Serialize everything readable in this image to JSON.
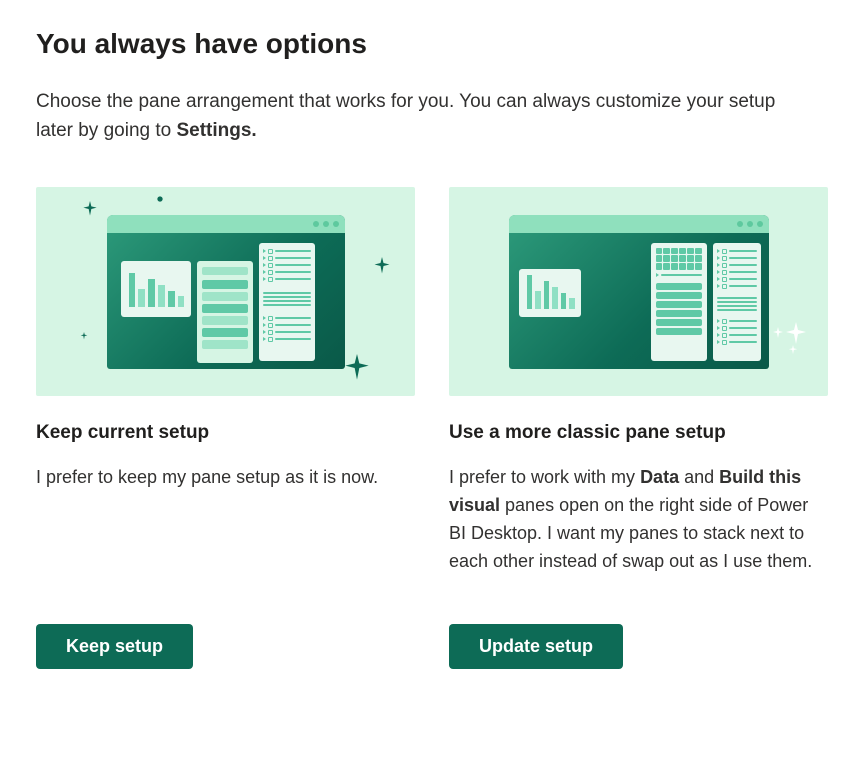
{
  "dialog": {
    "title": "You always have options",
    "subtitle_pre": "Choose the pane arrangement that works for you. You can always customize your setup later by going to ",
    "subtitle_bold": "Settings."
  },
  "options": {
    "keep": {
      "heading": "Keep current setup",
      "description": "I prefer to keep my pane setup as it is now.",
      "button_label": "Keep setup"
    },
    "classic": {
      "heading": "Use a more classic pane setup",
      "desc_p1": "I prefer to work with my ",
      "desc_b1": "Data",
      "desc_p2": " and ",
      "desc_b2": "Build this visual",
      "desc_p3": " panes open on the right side of Power BI Desktop. I want my panes to stack next to each other instead of swap out as I use them.",
      "button_label": "Update setup"
    }
  }
}
